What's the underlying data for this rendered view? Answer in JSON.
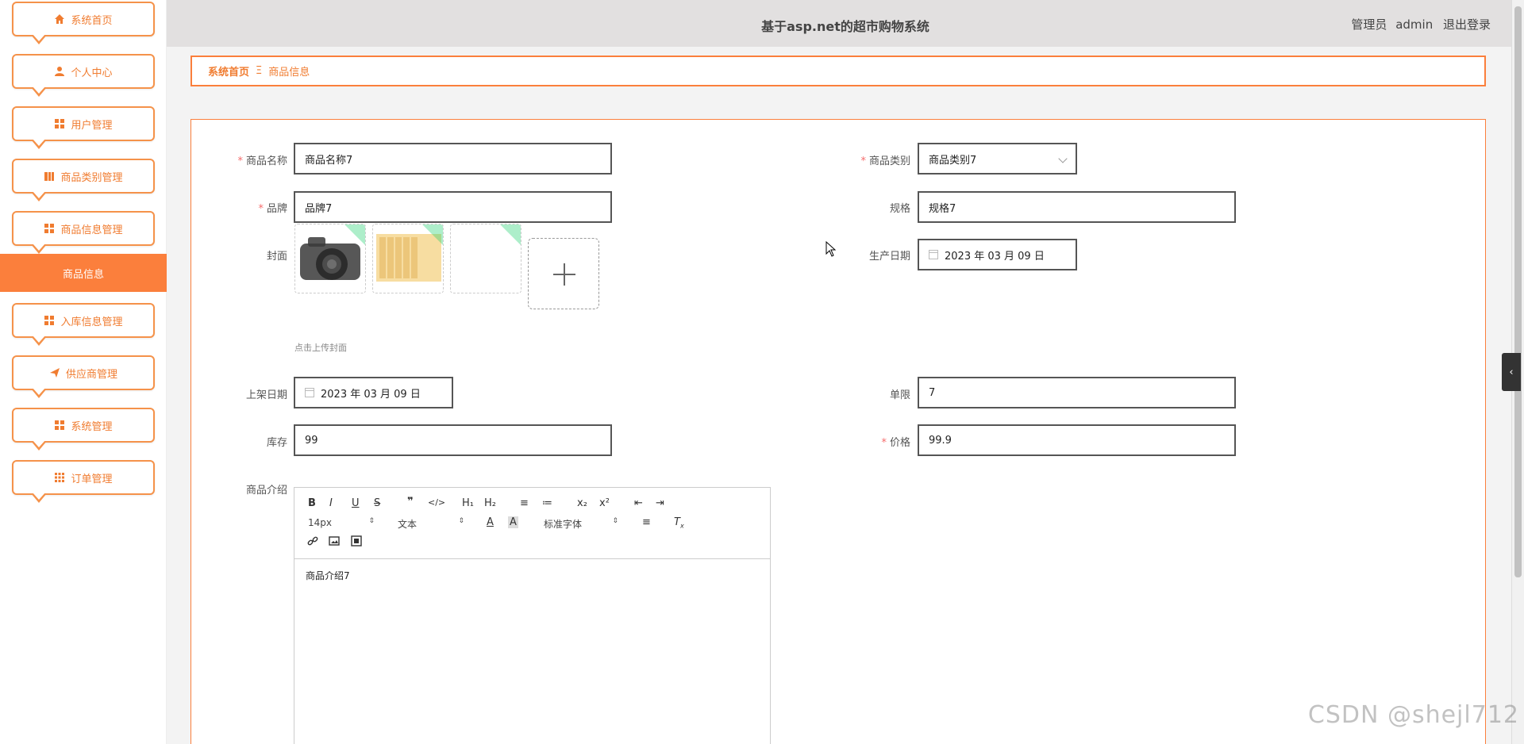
{
  "header": {
    "title": "基于asp.net的超市购物系统",
    "user_role": "管理员",
    "user_name": "admin",
    "logout": "退出登录"
  },
  "sidebar": {
    "items": [
      {
        "label": "系统首页",
        "icon": "home-icon"
      },
      {
        "label": "个人中心",
        "icon": "user-icon"
      },
      {
        "label": "用户管理",
        "icon": "grid-icon"
      },
      {
        "label": "商品类别管理",
        "icon": "book-icon"
      },
      {
        "label": "商品信息管理",
        "icon": "grid-icon"
      },
      {
        "label": "入库信息管理",
        "icon": "grid-icon"
      },
      {
        "label": "供应商管理",
        "icon": "send-icon"
      },
      {
        "label": "系统管理",
        "icon": "grid-icon"
      },
      {
        "label": "订单管理",
        "icon": "table-icon"
      }
    ],
    "active_sub": "商品信息"
  },
  "breadcrumb": {
    "home": "系统首页",
    "separator": "Ξ",
    "current": "商品信息"
  },
  "form": {
    "name_label": "商品名称",
    "name_value": "商品名称7",
    "category_label": "商品类别",
    "category_value": "商品类别7",
    "brand_label": "品牌",
    "brand_value": "品牌7",
    "spec_label": "规格",
    "spec_value": "规格7",
    "cover_label": "封面",
    "cover_hint": "点击上传封面",
    "prod_date_label": "生产日期",
    "prod_date_value": "2023 年 03 月 09 日",
    "shelf_date_label": "上架日期",
    "shelf_date_value": "2023 年 03 月 09 日",
    "limit_label": "单限",
    "limit_value": "7",
    "stock_label": "库存",
    "stock_value": "99",
    "price_label": "价格",
    "price_value": "99.9",
    "intro_label": "商品介绍",
    "required_mark": "*"
  },
  "editor": {
    "toolbar_row1": [
      "B",
      "I",
      "U",
      "S",
      "❞",
      "</>",
      "H₁",
      "H₂",
      "≡",
      "≔",
      "x₂",
      "x²",
      "⇤",
      "⇥"
    ],
    "font_size": "14px",
    "block_type": "文本",
    "font_family": "标准字体",
    "content": "商品介绍7"
  },
  "watermark": "CSDN @shejl712",
  "colors": {
    "accent": "#fb7f3c",
    "required": "#f56c6c"
  }
}
